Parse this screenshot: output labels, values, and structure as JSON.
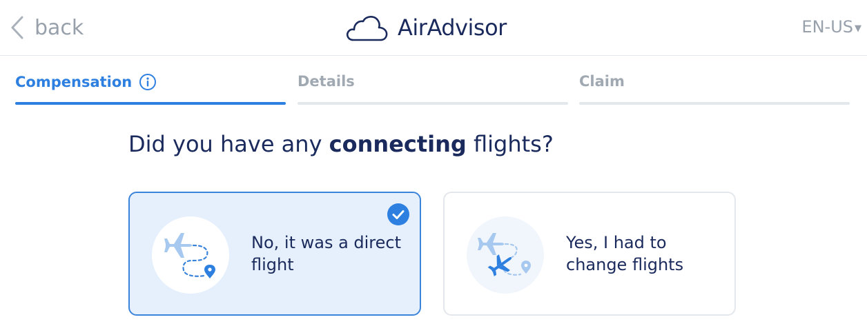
{
  "header": {
    "back_label": "back",
    "brand_name": "AirAdvisor",
    "language": "EN-US"
  },
  "steps": [
    {
      "label": "Compensation",
      "active": true
    },
    {
      "label": "Details",
      "active": false
    },
    {
      "label": "Claim",
      "active": false
    }
  ],
  "question": {
    "prefix": "Did you have any ",
    "emphasis": "connecting",
    "suffix": " flights?"
  },
  "options": [
    {
      "label": "No, it was a direct flight",
      "selected": true,
      "icon": "direct-flight-icon"
    },
    {
      "label": "Yes, I had to change flights",
      "selected": false,
      "icon": "connecting-flights-icon"
    }
  ],
  "colors": {
    "accent": "#2d7fe0",
    "navy": "#1b2a5c",
    "muted": "#98a1ab",
    "selected_bg": "#e5f0fc"
  }
}
